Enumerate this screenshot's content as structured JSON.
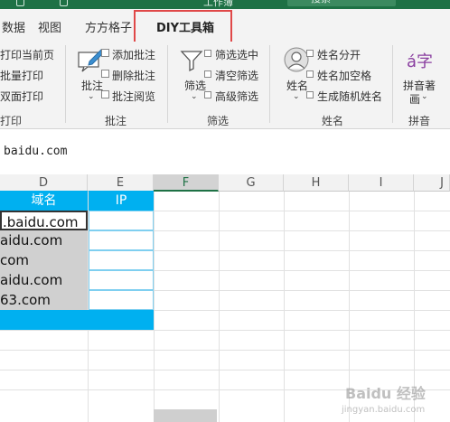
{
  "title_bar": {
    "title": "工作簿",
    "search": "搜索"
  },
  "tabs": [
    {
      "label": "数据"
    },
    {
      "label": "视图"
    },
    {
      "label": "方方格子"
    },
    {
      "label": "DIY工具箱"
    }
  ],
  "ribbon": {
    "print": {
      "items": [
        "打印当前页",
        "批量打印",
        "双面打印"
      ],
      "group": "打印"
    },
    "comment": {
      "main": "批注",
      "items": [
        "添加批注",
        "删除批注",
        "批注阅览"
      ],
      "group": "批注"
    },
    "filter": {
      "main": "筛选",
      "items": [
        "筛选选中",
        "清空筛选",
        "高级筛选"
      ],
      "group": "筛选"
    },
    "name": {
      "main": "姓名",
      "items": [
        "姓名分开",
        "姓名加空格",
        "生成随机姓名"
      ],
      "group": "姓名"
    },
    "pinyin": {
      "main_line1": "拼音著",
      "main_line2": "画",
      "glyph": "á字",
      "group": "拼音"
    }
  },
  "formula_bar": {
    "value": "baidu.com"
  },
  "columns": [
    "D",
    "E",
    "F",
    "G",
    "H",
    "I",
    "J"
  ],
  "table": {
    "header_domain": "域名",
    "header_ip": "IP",
    "rows": [
      ".baidu.com",
      "aidu.com",
      "com",
      "aidu.com",
      "63.com"
    ]
  },
  "watermark": {
    "text": "Baidu 经验",
    "sub": "jingyan.baidu.com"
  },
  "colors": {
    "excel_green": "#1e7145",
    "header_blue": "#00b0f0",
    "highlight_red": "#e04848"
  }
}
